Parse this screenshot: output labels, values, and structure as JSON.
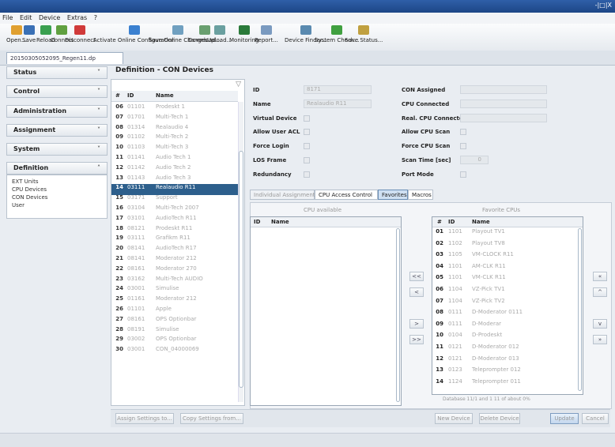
{
  "window": {
    "close_label": "-|□|X"
  },
  "menu": [
    "File",
    "Edit",
    "Device",
    "Extras",
    "?"
  ],
  "toolbar": [
    {
      "label": "Open...",
      "icon": "folder-icon",
      "color": "#e0a030"
    },
    {
      "label": "Save",
      "icon": "save-icon",
      "color": "#3a70b5"
    },
    {
      "label": "Reload",
      "icon": "reload-icon",
      "color": "#3aa050"
    },
    {
      "label": "Connect",
      "icon": "connect-icon",
      "color": "#60a040"
    },
    {
      "label": "Disconnect",
      "icon": "disconnect-icon",
      "color": "#d03a3a"
    },
    {
      "label": "Activate Online Configuration",
      "icon": "activate-icon",
      "color": "#3a80d0"
    },
    {
      "label": "Save Online Changes",
      "icon": "save-online-icon",
      "color": "#70a0c0"
    },
    {
      "label": "Download...",
      "icon": "download-icon",
      "color": "#6aa070"
    },
    {
      "label": "Upload...",
      "icon": "upload-icon",
      "color": "#6aa0a0"
    },
    {
      "label": "Monitoring",
      "icon": "monitoring-icon",
      "color": "#2a7a3a"
    },
    {
      "label": "Report...",
      "icon": "report-icon",
      "color": "#7a9ac0"
    },
    {
      "label": "Device Finder...",
      "icon": "device-finder-icon",
      "color": "#5a8ab0"
    },
    {
      "label": "System Check...",
      "icon": "system-check-icon",
      "color": "#40a040"
    },
    {
      "label": "Save Status...",
      "icon": "save-status-icon",
      "color": "#c0a040"
    }
  ],
  "doc_tab": "20150305052095_Regen11.dp",
  "nav": {
    "items": [
      "Status",
      "Control",
      "Administration",
      "Assignment",
      "System",
      "Definition"
    ],
    "sub": [
      "EXT Units",
      "CPU Devices",
      "CON Devices",
      "User"
    ]
  },
  "header": "Definition - CON Devices",
  "devlist": {
    "columns": [
      "#",
      "ID",
      "Name"
    ],
    "rows": [
      [
        "06",
        "01101",
        "Prodeskt 1"
      ],
      [
        "07",
        "01701",
        "Multi-Tech 1"
      ],
      [
        "08",
        "01314",
        "Realaudio 4"
      ],
      [
        "09",
        "01102",
        "Multi-Tech 2"
      ],
      [
        "10",
        "01103",
        "Multi-Tech 3"
      ],
      [
        "11",
        "01141",
        "Audio Tech 1"
      ],
      [
        "12",
        "01142",
        "Audio Tech 2"
      ],
      [
        "13",
        "01143",
        "Audio Tech 3"
      ],
      [
        "14",
        "03111",
        "Realaudio R11"
      ],
      [
        "15",
        "03171",
        "Support"
      ],
      [
        "16",
        "03104",
        "Multi-Tech 2007"
      ],
      [
        "17",
        "03101",
        "AudioTech R11"
      ],
      [
        "18",
        "08121",
        "Prodeskt R11"
      ],
      [
        "19",
        "03111",
        "Grafikm R11"
      ],
      [
        "20",
        "08141",
        "AudioTech R17"
      ],
      [
        "21",
        "08141",
        "Moderator 212"
      ],
      [
        "22",
        "08161",
        "Moderator 270"
      ],
      [
        "23",
        "03162",
        "Multi-Tech AUDIO"
      ],
      [
        "24",
        "03001",
        "Simulise"
      ],
      [
        "25",
        "01161",
        "Moderator 212"
      ],
      [
        "26",
        "01101",
        "Apple"
      ],
      [
        "27",
        "08161",
        "OPS Optionbar"
      ],
      [
        "28",
        "08191",
        "Simulise"
      ],
      [
        "29",
        "03002",
        "OPS Optionbar"
      ],
      [
        "30",
        "03001",
        "CON_04000069"
      ]
    ],
    "selected": 8
  },
  "props": {
    "left": [
      {
        "label": "ID",
        "value": "8171",
        "kind": "field"
      },
      {
        "label": "Name",
        "value": "Realaudio R11",
        "kind": "field"
      },
      {
        "label": "Virtual Device",
        "kind": "check"
      },
      {
        "label": "Allow User ACL",
        "kind": "check"
      },
      {
        "label": "Force Login",
        "kind": "check"
      },
      {
        "label": "LOS Frame",
        "kind": "check"
      },
      {
        "label": "Redundancy",
        "kind": "check"
      }
    ],
    "right": [
      {
        "label": "CON Assigned",
        "value": "",
        "kind": "field"
      },
      {
        "label": "CPU Connected",
        "value": "",
        "kind": "field"
      },
      {
        "label": "Real. CPU Connected",
        "value": "",
        "kind": "field"
      },
      {
        "label": "Allow CPU Scan",
        "kind": "check"
      },
      {
        "label": "Force CPU Scan",
        "kind": "check"
      },
      {
        "label": "Scan Time [sec]",
        "value": "0",
        "kind": "spinner"
      },
      {
        "label": "Port Mode",
        "kind": "check"
      }
    ]
  },
  "subtabs": [
    {
      "label": "Individual Assignment",
      "state": "off"
    },
    {
      "label": "CPU Access Control",
      "state": "on"
    },
    {
      "label": "Favorites",
      "state": "active"
    },
    {
      "label": "Macros",
      "state": "on"
    }
  ],
  "cpu_available": {
    "title": "CPU available",
    "columns": [
      "ID",
      "Name"
    ]
  },
  "favorites": {
    "title": "Favorite CPUs",
    "columns": [
      "#",
      "ID",
      "Name"
    ],
    "rows": [
      [
        "01",
        "1101",
        "Playout TV1"
      ],
      [
        "02",
        "1102",
        "Playout TV8"
      ],
      [
        "03",
        "1105",
        "VM-CLOCK R11"
      ],
      [
        "04",
        "1101",
        "AM-CLK R11"
      ],
      [
        "05",
        "1101",
        "VM-CLK R11"
      ],
      [
        "06",
        "1104",
        "VZ-Pick TV1"
      ],
      [
        "07",
        "1104",
        "VZ-Pick TV2"
      ],
      [
        "08",
        "0111",
        "D-Moderator 0111"
      ],
      [
        "09",
        "0111",
        "D-Moderar"
      ],
      [
        "10",
        "0104",
        "D-Prodeskt"
      ],
      [
        "11",
        "0121",
        "D-Moderator 012"
      ],
      [
        "12",
        "0121",
        "D-Moderator 013"
      ],
      [
        "13",
        "0123",
        "Teleprompter 012"
      ],
      [
        "14",
        "1124",
        "Teleprompter 011"
      ]
    ],
    "footer": "Database 11/1 and 1 11 of about 0%"
  },
  "move_buttons_mid": [
    "<<",
    "<",
    ">",
    ">>"
  ],
  "move_buttons_right": [
    "«",
    "^",
    "v",
    "»"
  ],
  "bottom_buttons": {
    "left": [
      "Assign Settings to...",
      "Copy Settings from..."
    ],
    "right": [
      "New Device",
      "Delete Device",
      "Update",
      "Cancel"
    ]
  }
}
